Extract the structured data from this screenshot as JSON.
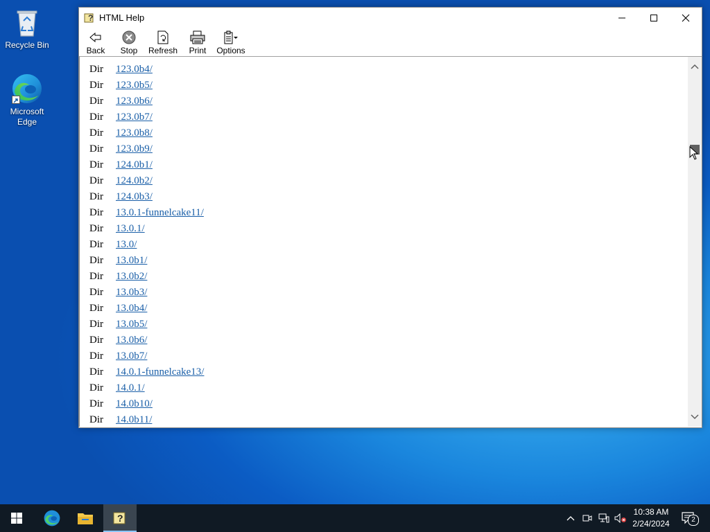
{
  "desktop": {
    "icons": [
      {
        "label": "Recycle Bin",
        "icon": "recycle-bin-icon"
      },
      {
        "label": "Microsoft Edge",
        "icon": "edge-icon"
      }
    ]
  },
  "window": {
    "title": "HTML Help",
    "title_icon": "help-question-icon",
    "controls": [
      "minimize",
      "maximize",
      "close"
    ]
  },
  "toolbar": {
    "back_label": "Back",
    "stop_label": "Stop",
    "refresh_label": "Refresh",
    "print_label": "Print",
    "options_label": "Options"
  },
  "listing": {
    "rows": [
      {
        "type": "Dir",
        "name": "123.0b4/"
      },
      {
        "type": "Dir",
        "name": "123.0b5/"
      },
      {
        "type": "Dir",
        "name": "123.0b6/"
      },
      {
        "type": "Dir",
        "name": "123.0b7/"
      },
      {
        "type": "Dir",
        "name": "123.0b8/"
      },
      {
        "type": "Dir",
        "name": "123.0b9/"
      },
      {
        "type": "Dir",
        "name": "124.0b1/"
      },
      {
        "type": "Dir",
        "name": "124.0b2/"
      },
      {
        "type": "Dir",
        "name": "124.0b3/"
      },
      {
        "type": "Dir",
        "name": "13.0.1-funnelcake11/"
      },
      {
        "type": "Dir",
        "name": "13.0.1/"
      },
      {
        "type": "Dir",
        "name": "13.0/"
      },
      {
        "type": "Dir",
        "name": "13.0b1/"
      },
      {
        "type": "Dir",
        "name": "13.0b2/"
      },
      {
        "type": "Dir",
        "name": "13.0b3/"
      },
      {
        "type": "Dir",
        "name": "13.0b4/"
      },
      {
        "type": "Dir",
        "name": "13.0b5/"
      },
      {
        "type": "Dir",
        "name": "13.0b6/"
      },
      {
        "type": "Dir",
        "name": "13.0b7/"
      },
      {
        "type": "Dir",
        "name": "14.0.1-funnelcake13/"
      },
      {
        "type": "Dir",
        "name": "14.0.1/"
      },
      {
        "type": "Dir",
        "name": "14.0b10/"
      },
      {
        "type": "Dir",
        "name": "14.0b11/"
      }
    ],
    "link_color": "#1a5fa8"
  },
  "taskbar": {
    "items": [
      "start-icon",
      "edge-icon",
      "file-explorer-icon",
      "html-help-icon"
    ],
    "active_item": "html-help-icon",
    "tray_icons": [
      "chevron-up-icon",
      "meet-now-icon",
      "network-icon",
      "volume-muted-icon"
    ],
    "time": "10:38 AM",
    "date": "2/24/2024",
    "notification_count": "2"
  },
  "colors": {
    "taskbar": "#101a24",
    "desktop_accent": "#1a86dd"
  }
}
